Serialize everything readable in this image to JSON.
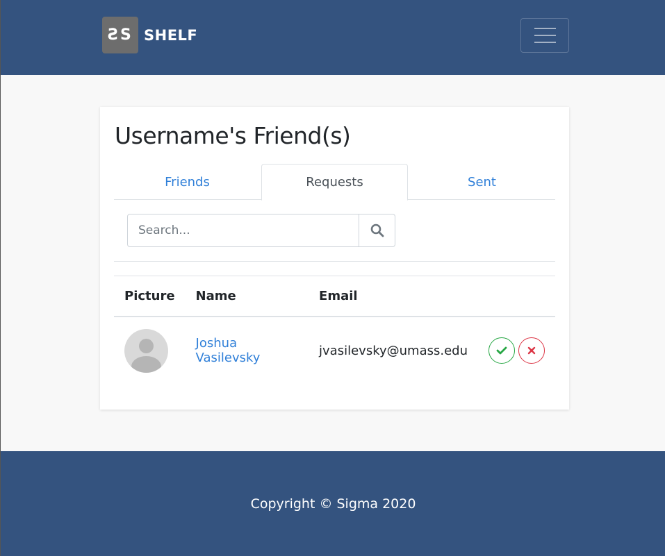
{
  "navbar": {
    "logo_text": "ƧS",
    "brand_name": "SHELF",
    "menu_icon": "hamburger-icon"
  },
  "card": {
    "title": "Username's Friend(s)",
    "tabs": [
      {
        "label": "Friends",
        "active": false
      },
      {
        "label": "Requests",
        "active": true
      },
      {
        "label": "Sent",
        "active": false
      }
    ]
  },
  "search": {
    "placeholder": "Search...",
    "value": "",
    "icon": "search-icon"
  },
  "table": {
    "headers": [
      "Picture",
      "Name",
      "Email",
      ""
    ],
    "rows": [
      {
        "picture": "avatar-placeholder",
        "name": "Joshua Vasilevsky",
        "email": "jvasilevsky@umass.edu",
        "accept_icon": "check-icon",
        "decline_icon": "close-icon"
      }
    ]
  },
  "colors": {
    "navbar": "#34537f",
    "link": "#2f7fd8",
    "accept": "#28a745",
    "decline": "#dc3545"
  },
  "footer": {
    "copyright": "Copyright © Sigma 2020"
  }
}
